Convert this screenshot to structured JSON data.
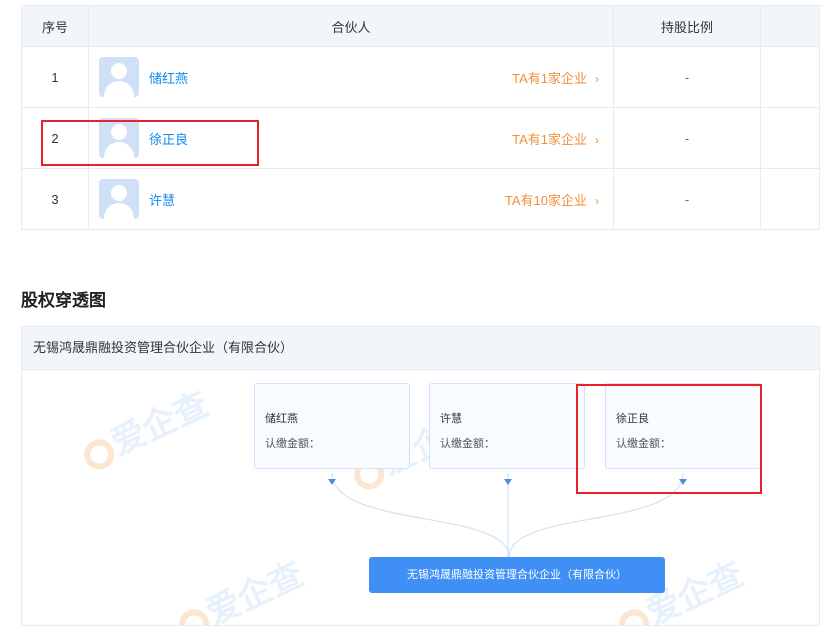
{
  "table": {
    "headers": [
      "序号",
      "合伙人",
      "持股比例"
    ],
    "rows": [
      {
        "index": "1",
        "name": "储红燕",
        "count": "TA有1家企业",
        "ratio": "-"
      },
      {
        "index": "2",
        "name": "徐正良",
        "count": "TA有1家企业",
        "ratio": "-"
      },
      {
        "index": "3",
        "name": "许慧",
        "count": "TA有10家企业",
        "ratio": "-"
      }
    ],
    "chevron": "›"
  },
  "section": {
    "title": "股权穿透图"
  },
  "graph": {
    "header": "无锡鸿晟鼎融投资管理合伙企业（有限合伙）",
    "nodes": [
      {
        "name": "储红燕",
        "amount_label": "认缴金额："
      },
      {
        "name": "许慧",
        "amount_label": "认缴金额："
      },
      {
        "name": "徐正良",
        "amount_label": "认缴金额："
      }
    ],
    "target": "无锡鸿晟鼎融投资管理合伙企业（有限合伙）",
    "watermark": "爱企查"
  },
  "colors": {
    "link": "#128bed",
    "accent": "#f18f3b",
    "highlight": "#e8212b",
    "button": "#3f8ff4"
  }
}
